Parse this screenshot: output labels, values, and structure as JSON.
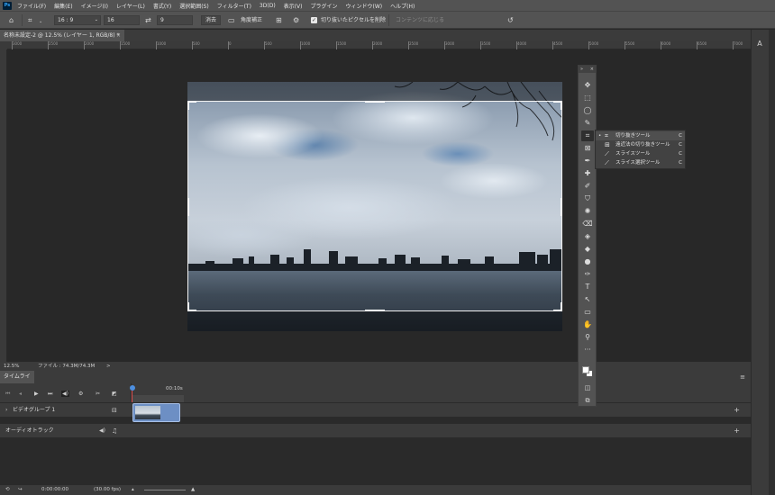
{
  "menu": {
    "logo": "Ps",
    "items": [
      "ファイル(F)",
      "編集(E)",
      "イメージ(I)",
      "レイヤー(L)",
      "書式(Y)",
      "選択範囲(S)",
      "フィルター(T)",
      "3D(D)",
      "表示(V)",
      "プラグイン",
      "ウィンドウ(W)",
      "ヘルプ(H)"
    ]
  },
  "options": {
    "ratio": "16 : 9",
    "width": "16",
    "height": "9",
    "clear_label": "消去",
    "straighten_label": "角度補正",
    "delete_cropped_label": "切り抜いたピクセルを削除",
    "delete_cropped_checked": true,
    "content_aware_label": "コンテンツに応じる"
  },
  "document": {
    "tab_title": "名称未設定-2 @ 12.5% (レイヤー 1, RGB/8) *",
    "close": "×"
  },
  "ruler": {
    "h_ticks": [
      "3000",
      "2500",
      "2000",
      "1500",
      "1000",
      "500",
      "0",
      "500",
      "1000",
      "1500",
      "2000",
      "2500",
      "3000",
      "3500",
      "4000",
      "4500",
      "5000",
      "5500",
      "6000",
      "6500",
      "7000"
    ]
  },
  "status": {
    "zoom": "12.5%",
    "file_info": "ファイル : 74.3M/74.3M",
    "arrow": ">"
  },
  "timeline": {
    "tab": "タイムライン",
    "time_marker": "00:10s",
    "video_group": "ビデオグループ 1",
    "audio_track": "オーディオトラック",
    "current_time": "0:00:00:00",
    "fps": "(30.00 fps)",
    "add": "+"
  },
  "tools": {
    "header_left": "»",
    "header_right": "×",
    "items": [
      "✥",
      "⬚",
      "◯",
      "✎",
      "⌗",
      "⊠",
      "✒",
      "✚",
      "✐",
      "⛉",
      "✺",
      "⌫",
      "◈",
      "◆",
      "●",
      "✑",
      "T",
      "↖",
      "▭",
      "✋",
      "⚲",
      "···"
    ]
  },
  "flyout": {
    "items": [
      {
        "bullet": "•",
        "icon": "⌗",
        "label": "切り抜きツール",
        "key": "C"
      },
      {
        "bullet": "",
        "icon": "⊞",
        "label": "遠近法の切り抜きツール",
        "key": "C"
      },
      {
        "bullet": "",
        "icon": "⟋",
        "label": "スライスツール",
        "key": "C"
      },
      {
        "bullet": "",
        "icon": "⟋",
        "label": "スライス選択ツール",
        "key": "C"
      }
    ]
  },
  "colors": {
    "app_bg": "#282828",
    "panel": "#535353",
    "crop_border": "#f2f2f2",
    "clip": "#6d8fc4"
  }
}
